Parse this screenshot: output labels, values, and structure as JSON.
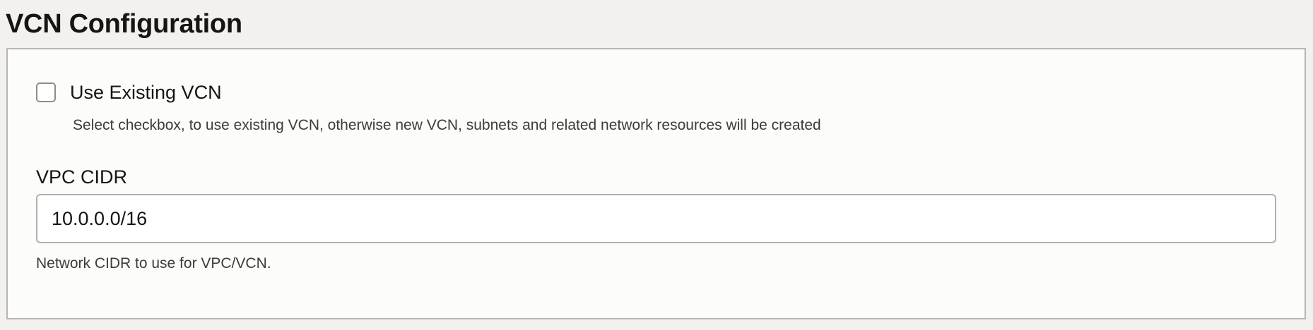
{
  "section": {
    "title": "VCN Configuration"
  },
  "use_existing_vcn": {
    "label": "Use Existing VCN",
    "checked": false,
    "help_text": "Select checkbox, to use existing VCN, otherwise new VCN, subnets and related network resources will be created"
  },
  "vpc_cidr": {
    "label": "VPC CIDR",
    "value": "10.0.0.0/16",
    "help_text": "Network CIDR to use for VPC/VCN."
  }
}
